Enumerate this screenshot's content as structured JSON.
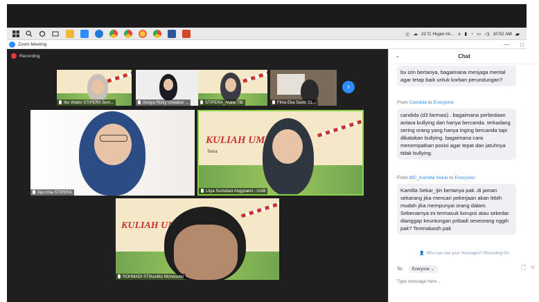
{
  "window": {
    "title": "Zoom Meeting",
    "minimize": "—",
    "maximize": "□"
  },
  "taskbar": {
    "weather": "31°C Hujan rin...",
    "time": "10:52 AM",
    "icons": [
      "windows-logo",
      "search-icon",
      "taskview-icon",
      "widgets-icon",
      "explorer-icon",
      "zoom-icon",
      "edge-icon",
      "chrome-icon",
      "chrome2-icon",
      "firefox-icon",
      "chrome3-icon",
      "word-icon",
      "powerpoint-icon"
    ]
  },
  "recording_label": "Recording",
  "participants": {
    "thumbs": [
      {
        "name": "Ibu Watini STIPERA Sem..."
      },
      {
        "name": "Anisya Rizky Uswatun ..."
      },
      {
        "name": "STIPERA_Atalia TIB"
      },
      {
        "name": "Fitria Eka Sastri S1..."
      }
    ],
    "main": [
      {
        "name": "Ayu Irna-STIPERA"
      },
      {
        "name": "Litya Surisdani Anggraeni - UniB"
      },
      {
        "name": "ROHMADI STIKesMu Wonosobo"
      }
    ],
    "poster_title": "KULIAH UMUM",
    "poster_title_partial": "KULIAH UM",
    "poster_tema": "Tema"
  },
  "chat": {
    "title": "Chat",
    "messages": [
      {
        "from": "",
        "to": "",
        "text": "bu izin bertanya, bagaimana menjaga mental agar tetap baik untuk korban perundungan?"
      },
      {
        "from": "Candida",
        "to": "Everyone",
        "text": "candida (d3 farmasi) . bagaimana perbedaan antara bullying dan hanya bercanda. terkadang sering orang yang hanya inging bercanda tapi dikatakan bullying. bagaimana cara menempatkan posisi agar tepat dan jatuhnya tidak bullying."
      },
      {
        "from": "MC_Kamilla Sekar",
        "to": "Everyone",
        "text": "Kamilla Sekar_ijin bertanya pak..di jaman sekarang jika mencari pekerjaan akan lebih mudah jika mempunyai orang dalam. Sebenarnya ini termasuk korupsi atau sekedar dianggap keuntungan pribadi seseorang nggih pak? Terimakasih pak"
      }
    ],
    "from_word": "From",
    "to_word": "to",
    "who_can_see": "Who can see your messages? Recording On",
    "to_label": "To:",
    "recipient": "Everyone",
    "message_placeholder": "Type message here..."
  },
  "colors": {
    "zoom_blue": "#2d8cff",
    "record_red": "#e03c3c",
    "stage_bg": "#1f1f1f"
  }
}
